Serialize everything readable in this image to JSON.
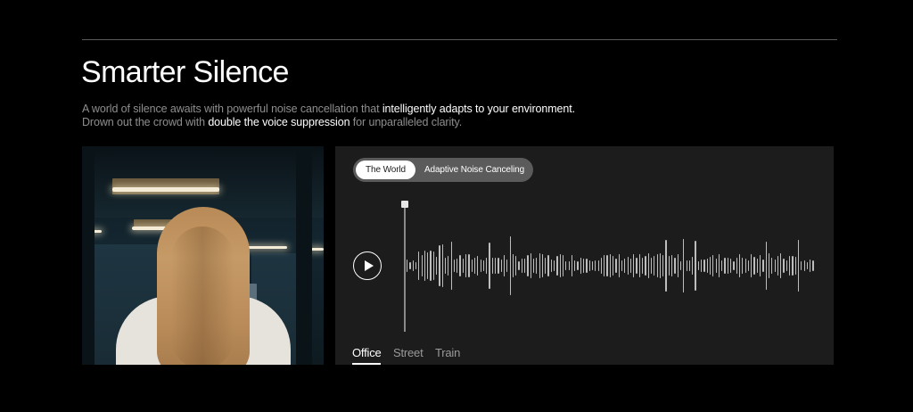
{
  "section": {
    "title": "Smarter Silence",
    "description": {
      "line1_start": "A world of silence awaits with powerful noise cancellation that ",
      "line1_highlight": "intelligently adapts to your environment.",
      "line2_start": "Drown out the crowd with ",
      "line2_highlight": "double the voice suppression",
      "line2_end": " for unparalleled clarity."
    }
  },
  "audio_demo": {
    "modes": [
      {
        "label": "The World",
        "selected": true
      },
      {
        "label": "Adaptive Noise Canceling",
        "selected": false
      }
    ],
    "play_icon": "play-icon",
    "environments": [
      {
        "label": "Office",
        "selected": true
      },
      {
        "label": "Street",
        "selected": false
      },
      {
        "label": "Train",
        "selected": false
      }
    ]
  },
  "colors": {
    "background": "#000000",
    "panel": "#1c1c1c",
    "toggle_track": "#5b5b5b",
    "waveform": "#bdbdbd",
    "muted_text": "#8e8e8e"
  }
}
